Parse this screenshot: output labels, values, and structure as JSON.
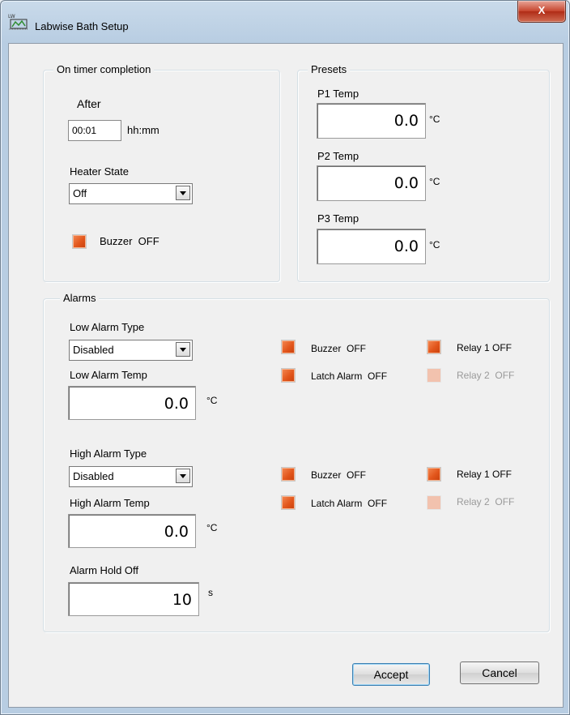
{
  "window": {
    "title": "Labwise Bath Setup",
    "close_glyph": "X"
  },
  "timer": {
    "group_title": "On timer completion",
    "after_label": "After",
    "after_value": "00:01",
    "after_unit": "hh:mm",
    "heater_label": "Heater State",
    "heater_value": "Off",
    "buzzer_label": "Buzzer  OFF"
  },
  "presets": {
    "group_title": "Presets",
    "items": [
      {
        "label": "P1 Temp",
        "value": "0.0",
        "unit": "°C"
      },
      {
        "label": "P2 Temp",
        "value": "0.0",
        "unit": "°C"
      },
      {
        "label": "P3 Temp",
        "value": "0.0",
        "unit": "°C"
      }
    ]
  },
  "alarms": {
    "group_title": "Alarms",
    "low": {
      "type_label": "Low Alarm Type",
      "type_value": "Disabled",
      "temp_label": "Low Alarm Temp",
      "temp_value": "0.0",
      "temp_unit": "°C",
      "buzzer": "Buzzer  OFF",
      "latch": "Latch Alarm  OFF",
      "relay1": "Relay 1 OFF",
      "relay2": "Relay 2  OFF"
    },
    "high": {
      "type_label": "High Alarm Type",
      "type_value": "Disabled",
      "temp_label": "High Alarm Temp",
      "temp_value": "0.0",
      "temp_unit": "°C",
      "buzzer": "Buzzer  OFF",
      "latch": "Latch Alarm  OFF",
      "relay1": "Relay 1 OFF",
      "relay2": "Relay 2  OFF"
    },
    "holdoff_label": "Alarm Hold Off",
    "holdoff_value": "10",
    "holdoff_unit": "s"
  },
  "buttons": {
    "accept": "Accept",
    "cancel": "Cancel"
  },
  "colors": {
    "led_on": "#e2561c",
    "led_disabled": "#f2c2ae",
    "default_button_border": "#3c7fb1"
  }
}
